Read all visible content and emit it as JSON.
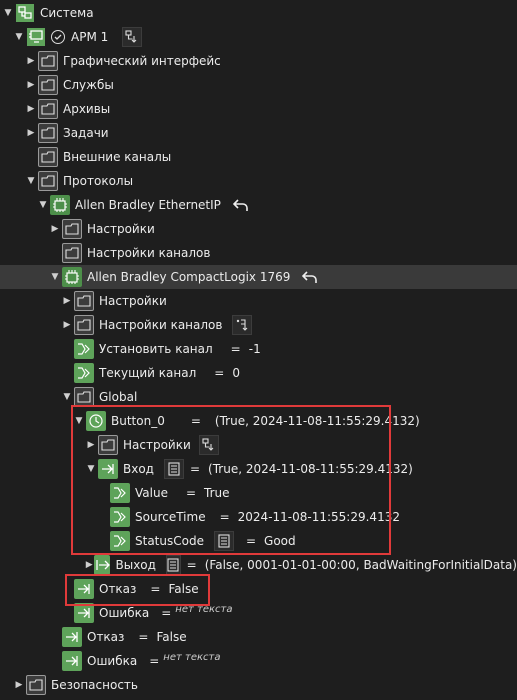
{
  "tree": {
    "system": "Система",
    "arm": "АРМ 1",
    "graphic": "Графический интерфейс",
    "services": "Службы",
    "archives": "Архивы",
    "tasks": "Задачи",
    "external_channels": "Внешние каналы",
    "protocols": "Протоколы",
    "ab_ethernet": "Allen Bradley EthernetIP",
    "ab_settings": "Настройки",
    "ab_channel_settings": "Настройки каналов",
    "compactlogix": "Allen Bradley CompactLogix 1769",
    "cl_settings": "Настройки",
    "cl_channel_settings": "Настройки каналов",
    "set_channel": "Установить канал",
    "set_channel_value": "-1",
    "current_channel": "Текущий канал",
    "current_channel_value": "0",
    "global": "Global",
    "button0": "Button_0",
    "button0_value": "(True, 2024-11-08-11:55:29.4132)",
    "btn_settings": "Настройки",
    "input": "Вход",
    "input_value": "(True, 2024-11-08-11:55:29.4132)",
    "value": "Value",
    "value_value": "True",
    "source_time": "SourceTime",
    "source_time_value": "2024-11-08-11:55:29.4132",
    "status_code": "StatusCode",
    "status_code_value": "Good",
    "output": "Выход",
    "output_value": "(False, 0001-01-01-00:00, BadWaitingForInitialData)",
    "fault": "Отказ",
    "fault_value": "False",
    "error": "Ошибка",
    "error_value": "нет текста",
    "fault2": "Отказ",
    "fault2_value": "False",
    "error2": "Ошибка",
    "error2_value": "нет текста",
    "security": "Безопасность"
  },
  "eq": "="
}
